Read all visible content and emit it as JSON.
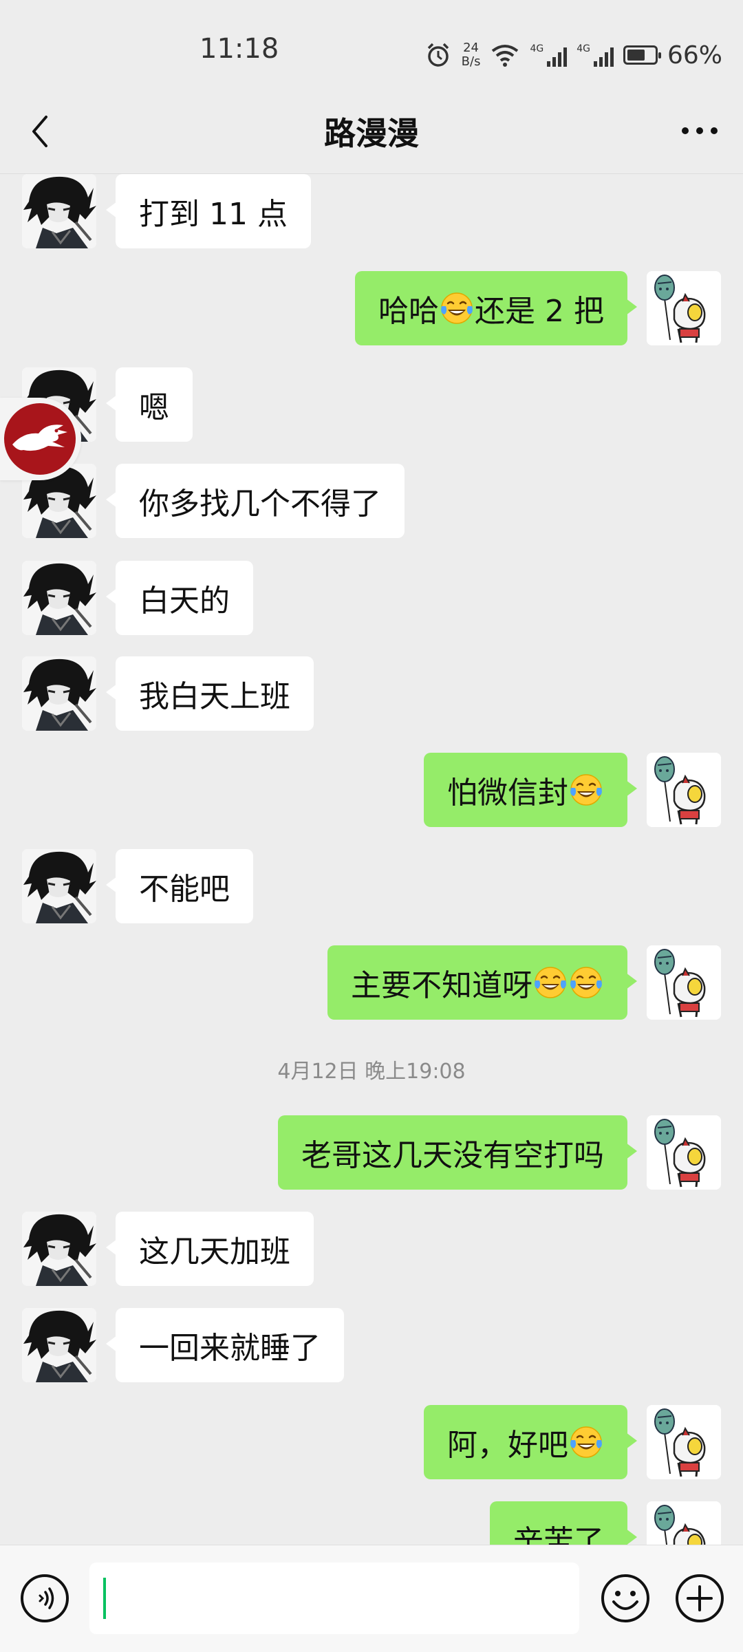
{
  "status_bar": {
    "time": "11:18",
    "net_speed_value": "24",
    "net_speed_unit": "B/s",
    "signal1_label": "4G",
    "signal2_label": "4G",
    "battery_percent": "66%",
    "battery_level": 0.66
  },
  "header": {
    "title": "路漫漫"
  },
  "messages": [
    {
      "side": "in",
      "text": "打到 11 点"
    },
    {
      "side": "out",
      "pre": "哈哈",
      "emoji": "tears-of-joy",
      "post": "还是 2 把"
    },
    {
      "side": "in",
      "text": "嗯"
    },
    {
      "side": "in",
      "text": "你多找几个不得了"
    },
    {
      "side": "in",
      "text": "白天的"
    },
    {
      "side": "in",
      "text": "我白天上班"
    },
    {
      "side": "out",
      "pre": "怕微信封",
      "emoji": "tears-of-joy",
      "post": ""
    },
    {
      "side": "in",
      "text": "不能吧"
    },
    {
      "side": "out",
      "pre": "主要不知道呀",
      "emoji": "tears-of-joy x2",
      "post": ""
    },
    {
      "side": "out",
      "text": "老哥这几天没有空打吗"
    },
    {
      "side": "in",
      "text": "这几天加班"
    },
    {
      "side": "in",
      "text": "一回来就睡了"
    },
    {
      "side": "out",
      "pre": "阿，好吧",
      "emoji": "tears-of-joy",
      "post": ""
    },
    {
      "side": "out",
      "text": "辛苦了"
    }
  ],
  "timestamp": "4月12日 晚上19:08",
  "colors": {
    "background": "#ededed",
    "outgoing_bubble": "#95ec69",
    "incoming_bubble": "#ffffff",
    "caret": "#07c160",
    "badge_red": "#a8151b"
  },
  "icons": {
    "back": "chevron-left-icon",
    "more": "more-dots-icon",
    "voice": "voice-icon",
    "emoji": "smiley-icon",
    "plus": "plus-icon",
    "emoji_in_text": "tears-of-joy-emoji"
  },
  "input": {
    "value": ""
  }
}
